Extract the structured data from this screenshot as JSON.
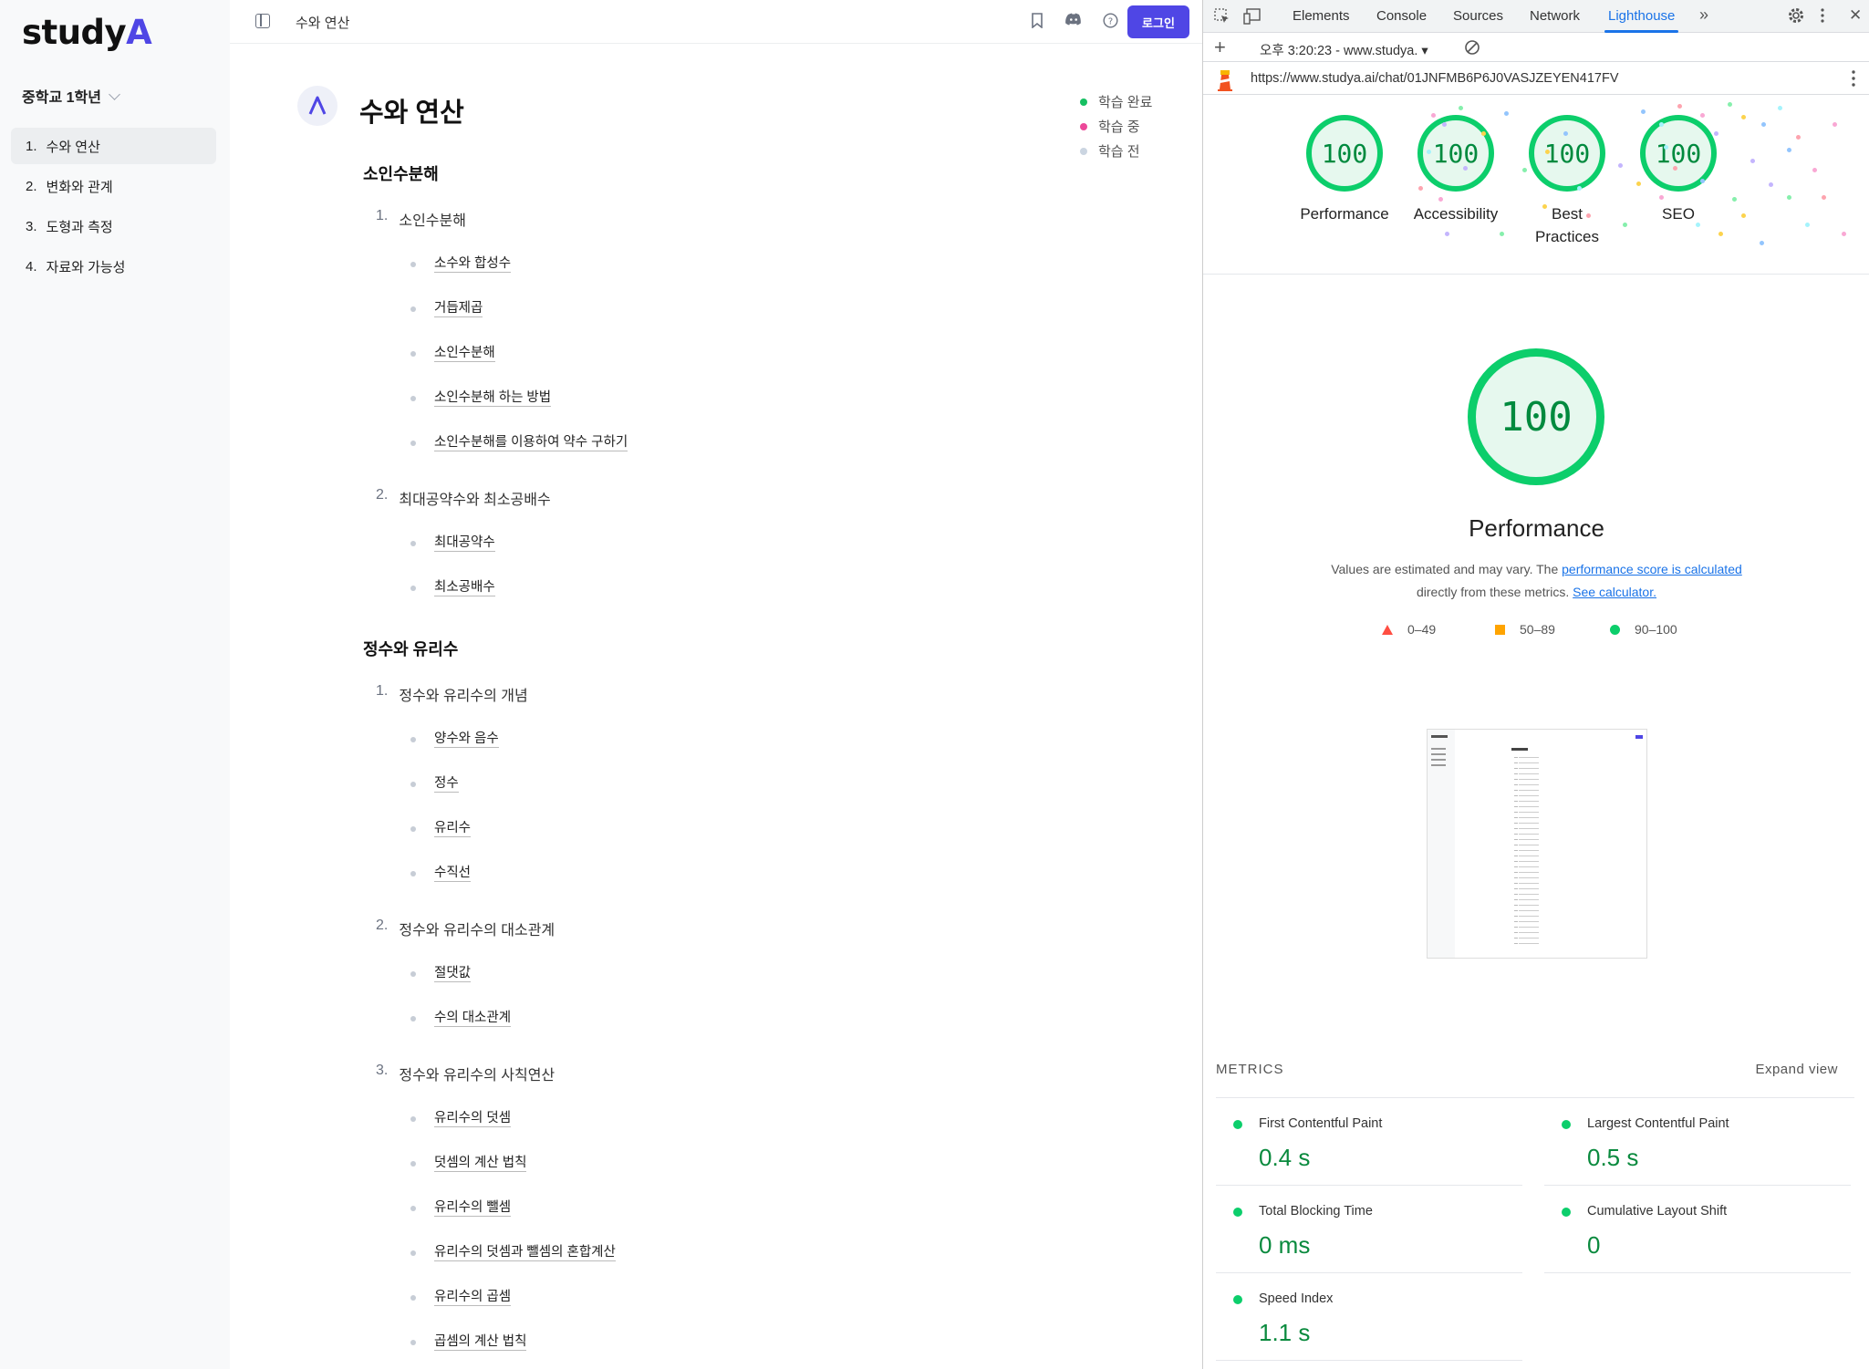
{
  "app": {
    "logo_text": "study",
    "logo_accent": "A",
    "grade": "중학교 1학년",
    "sidebar": [
      {
        "num": "1.",
        "label": "수와 연산",
        "active": true
      },
      {
        "num": "2.",
        "label": "변화와 관계",
        "active": false
      },
      {
        "num": "3.",
        "label": "도형과 측정",
        "active": false
      },
      {
        "num": "4.",
        "label": "자료와 가능성",
        "active": false
      }
    ],
    "topbar_title": "수와 연산",
    "login_label": "로그인",
    "page_title": "수와 연산",
    "legend": [
      {
        "label": "학습 완료",
        "color": "#16c062"
      },
      {
        "label": "학습 중",
        "color": "#ec4899"
      },
      {
        "label": "학습 전",
        "color": "#cbd5e1"
      }
    ],
    "sections": [
      {
        "title": "소인수분해",
        "chapters": [
          {
            "num": "1.",
            "title": "소인수분해",
            "topics": [
              "소수와 합성수",
              "거듭제곱",
              "소인수분해",
              "소인수분해 하는 방법",
              "소인수분해를 이용하여 약수 구하기"
            ]
          },
          {
            "num": "2.",
            "title": "최대공약수와 최소공배수",
            "topics": [
              "최대공약수",
              "최소공배수"
            ]
          }
        ]
      },
      {
        "title": "정수와 유리수",
        "chapters": [
          {
            "num": "1.",
            "title": "정수와 유리수의 개념",
            "topics": [
              "양수와 음수",
              "정수",
              "유리수",
              "수직선"
            ]
          },
          {
            "num": "2.",
            "title": "정수와 유리수의 대소관계",
            "topics": [
              "절댓값",
              "수의 대소관계"
            ]
          },
          {
            "num": "3.",
            "title": "정수와 유리수의 사칙연산",
            "topics": [
              "유리수의 덧셈",
              "덧셈의 계산 법칙",
              "유리수의 뺄셈",
              "유리수의 덧셈과 뺄셈의 혼합계산",
              "유리수의 곱셈",
              "곱셈의 계산 법칙"
            ]
          }
        ]
      }
    ]
  },
  "devtools": {
    "tabs": [
      "Elements",
      "Console",
      "Sources",
      "Network",
      "Lighthouse"
    ],
    "active_tab": "Lighthouse",
    "report_time": "오후 3:20:23 - www.studya.",
    "url": "https://www.studya.ai/chat/01JNFMB6P6J0VASJZEYEN417FV",
    "scores": [
      {
        "label": "Performance",
        "score": "100"
      },
      {
        "label": "Accessibility",
        "score": "100"
      },
      {
        "label": "Best Practices",
        "score": "100"
      },
      {
        "label": "SEO",
        "score": "100"
      }
    ],
    "big_score": "100",
    "big_title": "Performance",
    "desc_pre": "Values are estimated and may vary. The ",
    "desc_link1": "performance score is calculated",
    "desc_mid": " directly from these metrics. ",
    "desc_link2": "See calculator.",
    "ranges": [
      "0–49",
      "50–89",
      "90–100"
    ],
    "metrics_title": "METRICS",
    "expand_label": "Expand view",
    "metrics": [
      {
        "label": "First Contentful Paint",
        "value": "0.4 s"
      },
      {
        "label": "Largest Contentful Paint",
        "value": "0.5 s"
      },
      {
        "label": "Total Blocking Time",
        "value": "0 ms"
      },
      {
        "label": "Cumulative Layout Shift",
        "value": "0"
      },
      {
        "label": "Speed Index",
        "value": "1.1 s"
      }
    ]
  }
}
